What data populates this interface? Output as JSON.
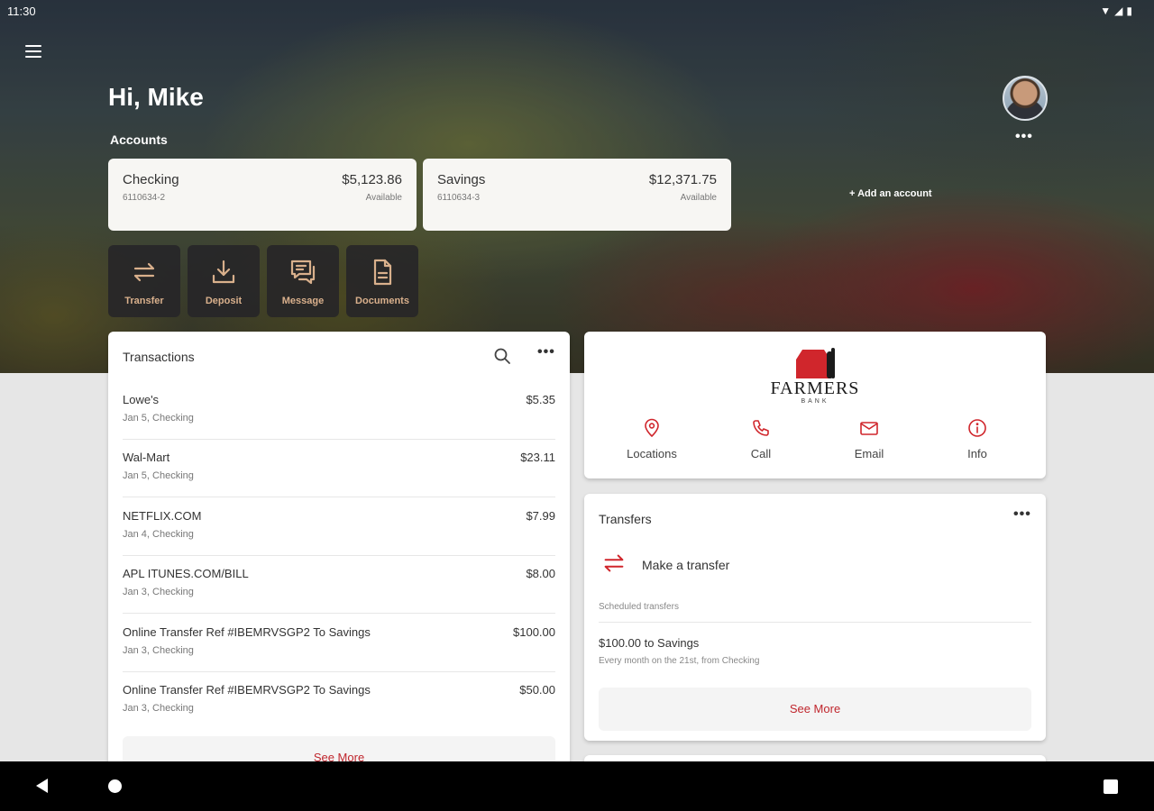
{
  "status_bar": {
    "time": "11:30"
  },
  "header": {
    "greeting": "Hi, Mike",
    "accounts_label": "Accounts",
    "add_account": "+ Add an account"
  },
  "accounts": [
    {
      "name": "Checking",
      "number": "6110634-2",
      "balance": "$5,123.86",
      "balance_label": "Available"
    },
    {
      "name": "Savings",
      "number": "6110634-3",
      "balance": "$12,371.75",
      "balance_label": "Available"
    }
  ],
  "actions": [
    {
      "label": "Transfer",
      "icon": "transfer-icon"
    },
    {
      "label": "Deposit",
      "icon": "deposit-icon"
    },
    {
      "label": "Message",
      "icon": "message-icon"
    },
    {
      "label": "Documents",
      "icon": "document-icon"
    }
  ],
  "transactions": {
    "title": "Transactions",
    "rows": [
      {
        "description": "Lowe's",
        "amount": "$5.35",
        "meta": "Jan 5, Checking"
      },
      {
        "description": "Wal-Mart",
        "amount": "$23.11",
        "meta": "Jan 5, Checking"
      },
      {
        "description": "NETFLIX.COM",
        "amount": "$7.99",
        "meta": "Jan 4, Checking"
      },
      {
        "description": "APL ITUNES.COM/BILL",
        "amount": "$8.00",
        "meta": "Jan 3, Checking"
      },
      {
        "description": "Online Transfer Ref #IBEMRVSGP2 To Savings",
        "amount": "$100.00",
        "meta": "Jan 3, Checking"
      },
      {
        "description": "Online Transfer Ref #IBEMRVSGP2 To Savings",
        "amount": "$50.00",
        "meta": "Jan 3, Checking"
      }
    ],
    "see_more": "See More"
  },
  "bank": {
    "logo_text": "FARMERS",
    "logo_subtext": "BANK",
    "brand_color": "#d0262c",
    "quick_links": [
      {
        "label": "Locations",
        "icon": "location-pin-icon"
      },
      {
        "label": "Call",
        "icon": "phone-icon"
      },
      {
        "label": "Email",
        "icon": "email-icon"
      },
      {
        "label": "Info",
        "icon": "info-icon"
      }
    ]
  },
  "transfers": {
    "title": "Transfers",
    "make_transfer": "Make a transfer",
    "scheduled_label": "Scheduled transfers",
    "scheduled": [
      {
        "title": "$100.00 to Savings",
        "detail": "Every month on the 21st, from Checking"
      }
    ],
    "see_more": "See More"
  }
}
